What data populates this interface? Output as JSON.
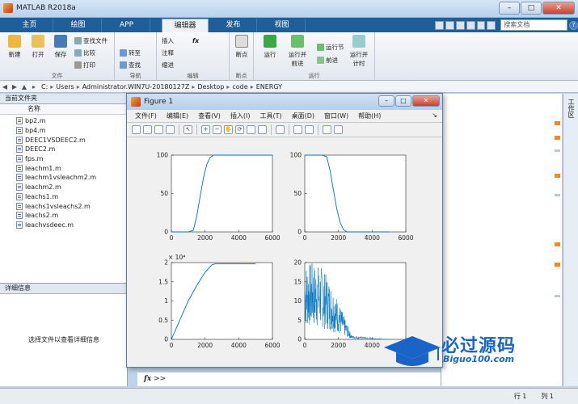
{
  "app": {
    "title": "MATLAB R2018a"
  },
  "window_buttons": {
    "minimize": "–",
    "maximize": "□",
    "close": "✕"
  },
  "main_tabs": [
    {
      "label": "主页"
    },
    {
      "label": "绘图"
    },
    {
      "label": "APP"
    },
    {
      "label": "编辑器"
    },
    {
      "label": "发布"
    },
    {
      "label": "视图"
    }
  ],
  "search": {
    "placeholder": "搜索文档"
  },
  "toolstrip": {
    "file": {
      "label": "文件",
      "new": "新建",
      "open": "打开",
      "save": "保存",
      "find_files": "查找文件",
      "compare": "比较",
      "print": "打印"
    },
    "navigate": {
      "label": "导航",
      "goto": "转至",
      "find": "查找"
    },
    "edit": {
      "label": "编辑",
      "insert": "插入",
      "comment": "注释",
      "indent": "缩进",
      "fx": "fx"
    },
    "breakpoints": {
      "label": "断点",
      "breakpoints": "断点"
    },
    "run": {
      "label": "运行",
      "run": "运行",
      "run_advance_1": "运行并",
      "run_advance_2": "前进",
      "run_section": "运行节",
      "advance": "前进",
      "run_time_1": "运行并",
      "run_time_2": "计时"
    }
  },
  "address": {
    "parts": [
      "C:",
      "Users",
      "Administrator.WIN7U-20180127Z",
      "Desktop",
      "code",
      "ENERGY"
    ]
  },
  "current_folder": {
    "title": "当前文件夹",
    "column_name": "名称",
    "files": [
      "bp2.m",
      "bp4.m",
      "DEEC1VSDEEC2.m",
      "DEEC2.m",
      "fps.m",
      "leachm1.m",
      "leachm1vsleachm2.m",
      "leachm2.m",
      "leachs1.m",
      "leachs1vsleachs2.m",
      "leachs2.m",
      "leachvsdeec.m"
    ]
  },
  "details": {
    "title": "详细信息",
    "message": "选择文件以查看详细信息"
  },
  "workspace": {
    "label": "工作区"
  },
  "command": {
    "fx": "fx",
    "prompt": ">>"
  },
  "status": {
    "row_label": "行",
    "row": "1",
    "col_label": "列",
    "col": "1"
  },
  "figure": {
    "title": "Figure 1",
    "menus": [
      "文件(F)",
      "编辑(E)",
      "查看(V)",
      "插入(I)",
      "工具(T)",
      "桌面(D)",
      "窗口(W)",
      "帮助(H)"
    ],
    "corner": "↘"
  },
  "chart_data": [
    {
      "type": "line",
      "x": [
        0,
        1000,
        1300,
        1500,
        1700,
        1900,
        2100,
        2300,
        2500,
        6000
      ],
      "values": [
        0,
        0,
        2,
        20,
        45,
        70,
        88,
        97,
        100,
        100
      ],
      "xlim": [
        0,
        6000
      ],
      "ylim": [
        0,
        100
      ],
      "xticks": [
        "0",
        "2000",
        "4000",
        "6000"
      ],
      "yticks": [
        "0",
        "50",
        "100"
      ],
      "color": "#0072bd"
    },
    {
      "type": "line",
      "x": [
        0,
        1000,
        1300,
        1500,
        1700,
        1900,
        2100,
        2300,
        2500,
        5000
      ],
      "values": [
        100,
        100,
        98,
        80,
        55,
        30,
        12,
        3,
        0,
        0
      ],
      "xlim": [
        0,
        6000
      ],
      "ylim": [
        0,
        100
      ],
      "xticks": [
        "0",
        "2000",
        "4000",
        "6000"
      ],
      "yticks": [
        "0",
        "50",
        "100"
      ],
      "color": "#0072bd"
    },
    {
      "type": "line",
      "x": [
        0,
        500,
        1000,
        1500,
        2000,
        2400,
        2600,
        5000
      ],
      "values": [
        0,
        5000,
        10000,
        14000,
        17500,
        19400,
        19700,
        19700
      ],
      "xlim": [
        0,
        6000
      ],
      "ylim": [
        0,
        20000
      ],
      "xticks": [
        "0",
        "2000",
        "4000",
        "6000"
      ],
      "yticks": [
        "0",
        "0.5",
        "1",
        "1.5",
        "2"
      ],
      "yexponent": "× 10⁴",
      "color": "#0072bd"
    },
    {
      "type": "line",
      "description_style": "noisy",
      "x_range": [
        0,
        5000
      ],
      "envelope": {
        "x": [
          0,
          500,
          1000,
          1500,
          2000,
          2500,
          2800,
          5000
        ],
        "max": [
          20,
          20,
          19,
          15,
          10,
          4,
          1,
          0
        ]
      },
      "xlim": [
        0,
        6000
      ],
      "ylim": [
        0,
        20
      ],
      "xticks": [
        "0",
        "2000",
        "4000",
        "6000"
      ],
      "yticks": [
        "0",
        "5",
        "10",
        "15",
        "20"
      ],
      "color": "#0072bd"
    }
  ],
  "watermark": {
    "main": "必过源码",
    "sub": "Biguo100.com"
  }
}
